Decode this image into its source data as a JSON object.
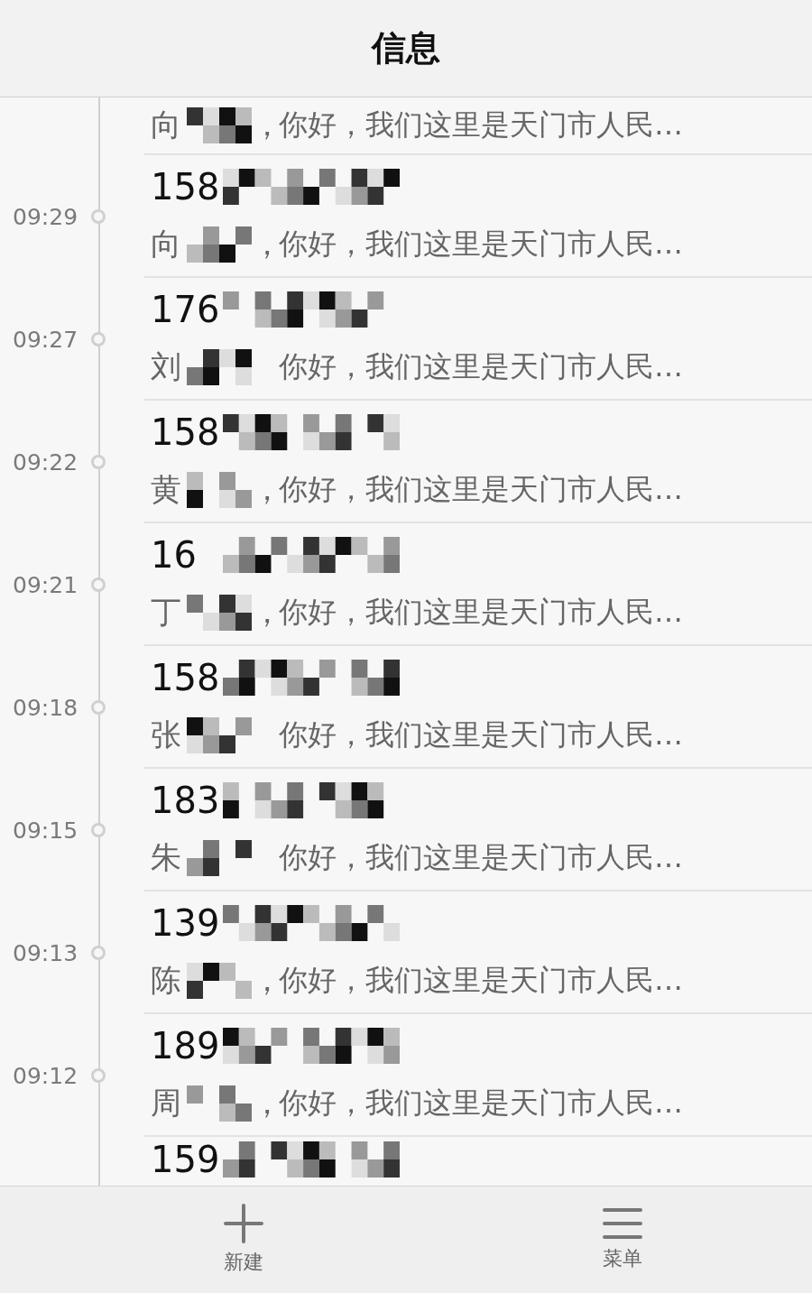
{
  "header": {
    "title": "信息"
  },
  "messages": [
    {
      "name": "向",
      "separator": "，",
      "message": "你好，我们这里是天门市人民…"
    },
    {
      "time": "09:29",
      "number": "158",
      "name": "向",
      "separator": "，",
      "message": "你好，我们这里是天门市人民…"
    },
    {
      "time": "09:27",
      "number": "176",
      "name": "刘",
      "message": "你好，我们这里是天门市人民…"
    },
    {
      "time": "09:22",
      "number": "158",
      "name": "黄",
      "separator": "，",
      "message": "你好，我们这里是天门市人民…"
    },
    {
      "time": "09:21",
      "number": "16",
      "name": "丁",
      "separator": "，",
      "message": "你好，我们这里是天门市人民…"
    },
    {
      "time": "09:18",
      "number": "158",
      "name": "张",
      "message": "你好，我们这里是天门市人民…"
    },
    {
      "time": "09:15",
      "number": "183",
      "name": "朱",
      "message": "你好，我们这里是天门市人民…"
    },
    {
      "time": "09:13",
      "number": "139",
      "name": "陈",
      "separator": "，",
      "message": "你好，我们这里是天门市人民…"
    },
    {
      "time": "09:12",
      "number": "189",
      "name": "周",
      "separator": "，",
      "message": "你好，我们这里是天门市人民…"
    },
    {
      "number": "159"
    }
  ],
  "toolbar": [
    {
      "kind": "new",
      "label": "新建"
    },
    {
      "kind": "menu",
      "label": "菜单"
    }
  ]
}
